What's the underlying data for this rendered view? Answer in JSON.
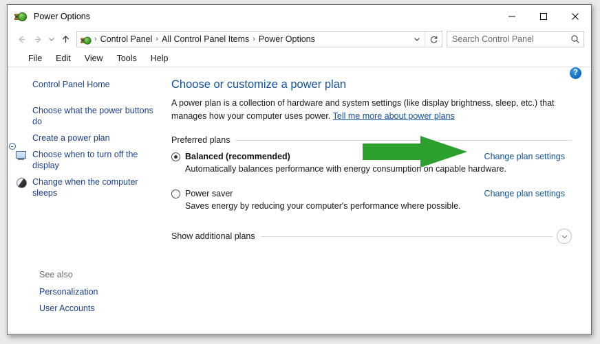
{
  "window": {
    "title": "Power Options",
    "icon": "power-plug-icon",
    "controls": {
      "minimize": "minimize",
      "maximize": "maximize",
      "close": "close"
    }
  },
  "addressbar": {
    "back": "back",
    "forward": "forward",
    "recent": "recent-pages",
    "up": "up",
    "icon": "power-plug-icon",
    "crumbs": [
      "Control Panel",
      "All Control Panel Items",
      "Power Options"
    ],
    "separator": "›",
    "dropdown": "address-dropdown",
    "refresh": "refresh"
  },
  "search": {
    "placeholder": "Search Control Panel",
    "value": "",
    "icon": "search-icon"
  },
  "menubar": {
    "items": [
      "File",
      "Edit",
      "View",
      "Tools",
      "Help"
    ]
  },
  "sidebar": {
    "home": "Control Panel Home",
    "items": [
      {
        "label": "Choose what the power buttons do",
        "icon": ""
      },
      {
        "label": "Create a power plan",
        "icon": ""
      },
      {
        "label": "Choose when to turn off the display",
        "icon": "display-clock-icon"
      },
      {
        "label": "Change when the computer sleeps",
        "icon": "sleep-moon-icon"
      }
    ],
    "see_also": {
      "header": "See also",
      "links": [
        "Personalization",
        "User Accounts"
      ]
    }
  },
  "content": {
    "help_button": "?",
    "title": "Choose or customize a power plan",
    "intro_text": "A power plan is a collection of hardware and system settings (like display brightness, sleep, etc.) that manages how your computer uses power. ",
    "intro_link": "Tell me more about power plans",
    "preferred_plans_label": "Preferred plans",
    "plans": [
      {
        "name": "Balanced (recommended)",
        "description": "Automatically balances performance with energy consumption on capable hardware.",
        "selected": true,
        "link": "Change plan settings"
      },
      {
        "name": "Power saver",
        "description": "Saves energy by reducing your computer's performance where possible.",
        "selected": false,
        "link": "Change plan settings"
      }
    ],
    "additional_plans_label": "Show additional plans",
    "expand_icon": "chevron-down-icon"
  },
  "annotation": {
    "type": "arrow",
    "color": "#2ca02c",
    "points_to": "Change plan settings"
  },
  "colors": {
    "link": "#11519b",
    "sidebar_link": "#1b3f8b",
    "arrow_green": "#2ca02c",
    "help_blue": "#1272c4"
  }
}
